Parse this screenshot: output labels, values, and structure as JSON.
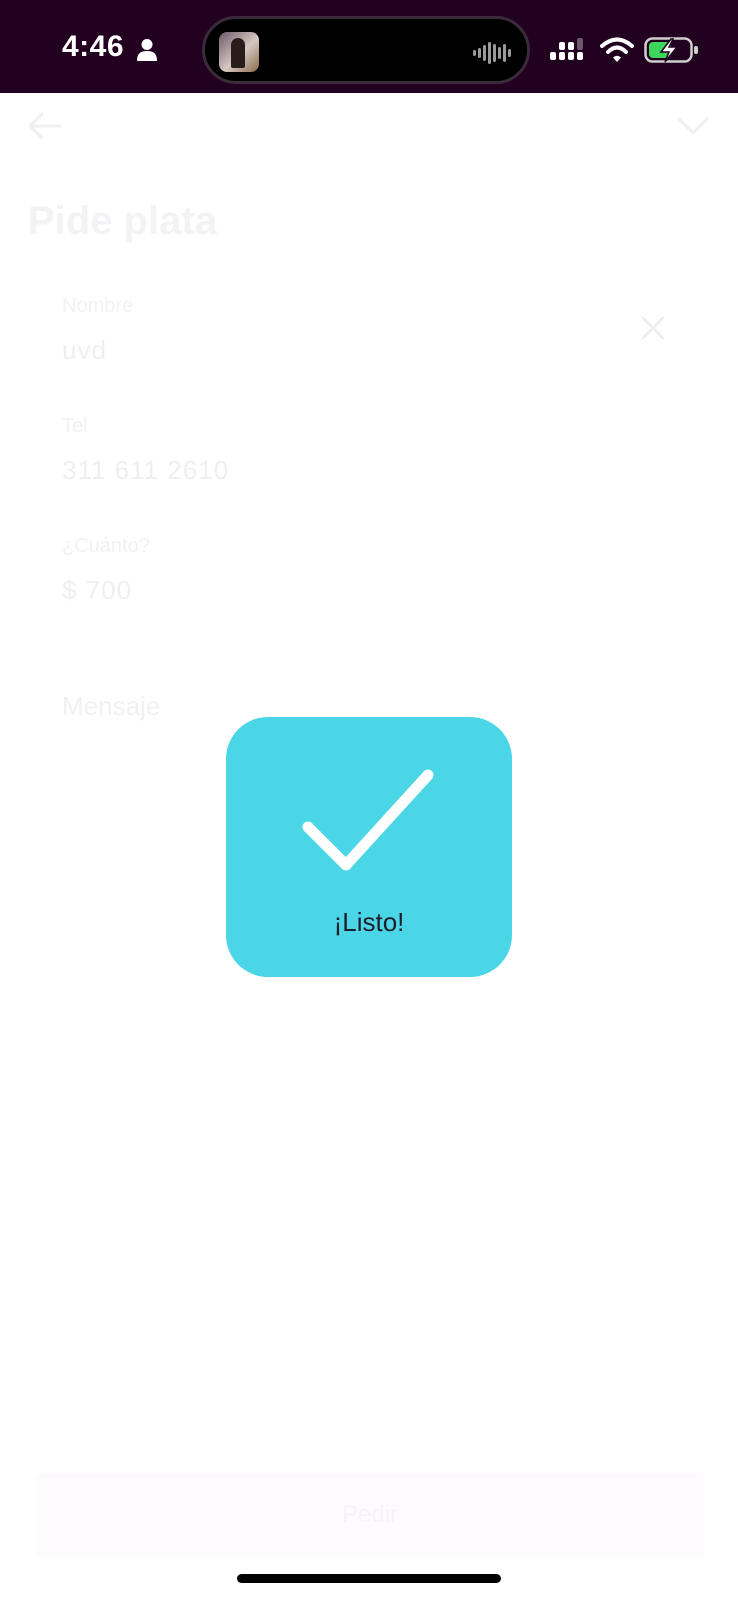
{
  "status_bar": {
    "time": "4:46",
    "colors": {
      "background": "#22001f",
      "battery_fill": "#3ed65a"
    }
  },
  "background_page": {
    "title": "Pide plata",
    "fields": [
      {
        "label": "Nombre",
        "value": "uvd"
      },
      {
        "label": "Tel",
        "value": "311 611 2610"
      },
      {
        "label": "¿Cuánto?",
        "value": "$ 700"
      }
    ],
    "message_label": "Mensaje",
    "submit_label": "Pedir"
  },
  "toast": {
    "label": "¡Listo!",
    "icon": "check-icon",
    "color": "#4bd6e8"
  }
}
